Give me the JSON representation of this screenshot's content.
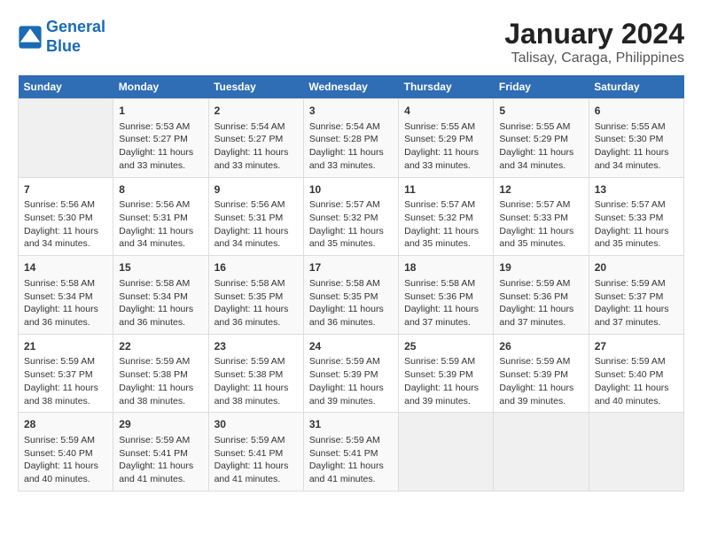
{
  "logo": {
    "line1": "General",
    "line2": "Blue"
  },
  "title": "January 2024",
  "subtitle": "Talisay, Caraga, Philippines",
  "headers": [
    "Sunday",
    "Monday",
    "Tuesday",
    "Wednesday",
    "Thursday",
    "Friday",
    "Saturday"
  ],
  "weeks": [
    [
      {
        "day": "",
        "info": ""
      },
      {
        "day": "1",
        "info": "Sunrise: 5:53 AM\nSunset: 5:27 PM\nDaylight: 11 hours\nand 33 minutes."
      },
      {
        "day": "2",
        "info": "Sunrise: 5:54 AM\nSunset: 5:27 PM\nDaylight: 11 hours\nand 33 minutes."
      },
      {
        "day": "3",
        "info": "Sunrise: 5:54 AM\nSunset: 5:28 PM\nDaylight: 11 hours\nand 33 minutes."
      },
      {
        "day": "4",
        "info": "Sunrise: 5:55 AM\nSunset: 5:29 PM\nDaylight: 11 hours\nand 33 minutes."
      },
      {
        "day": "5",
        "info": "Sunrise: 5:55 AM\nSunset: 5:29 PM\nDaylight: 11 hours\nand 34 minutes."
      },
      {
        "day": "6",
        "info": "Sunrise: 5:55 AM\nSunset: 5:30 PM\nDaylight: 11 hours\nand 34 minutes."
      }
    ],
    [
      {
        "day": "7",
        "info": "Sunrise: 5:56 AM\nSunset: 5:30 PM\nDaylight: 11 hours\nand 34 minutes."
      },
      {
        "day": "8",
        "info": "Sunrise: 5:56 AM\nSunset: 5:31 PM\nDaylight: 11 hours\nand 34 minutes."
      },
      {
        "day": "9",
        "info": "Sunrise: 5:56 AM\nSunset: 5:31 PM\nDaylight: 11 hours\nand 34 minutes."
      },
      {
        "day": "10",
        "info": "Sunrise: 5:57 AM\nSunset: 5:32 PM\nDaylight: 11 hours\nand 35 minutes."
      },
      {
        "day": "11",
        "info": "Sunrise: 5:57 AM\nSunset: 5:32 PM\nDaylight: 11 hours\nand 35 minutes."
      },
      {
        "day": "12",
        "info": "Sunrise: 5:57 AM\nSunset: 5:33 PM\nDaylight: 11 hours\nand 35 minutes."
      },
      {
        "day": "13",
        "info": "Sunrise: 5:57 AM\nSunset: 5:33 PM\nDaylight: 11 hours\nand 35 minutes."
      }
    ],
    [
      {
        "day": "14",
        "info": "Sunrise: 5:58 AM\nSunset: 5:34 PM\nDaylight: 11 hours\nand 36 minutes."
      },
      {
        "day": "15",
        "info": "Sunrise: 5:58 AM\nSunset: 5:34 PM\nDaylight: 11 hours\nand 36 minutes."
      },
      {
        "day": "16",
        "info": "Sunrise: 5:58 AM\nSunset: 5:35 PM\nDaylight: 11 hours\nand 36 minutes."
      },
      {
        "day": "17",
        "info": "Sunrise: 5:58 AM\nSunset: 5:35 PM\nDaylight: 11 hours\nand 36 minutes."
      },
      {
        "day": "18",
        "info": "Sunrise: 5:58 AM\nSunset: 5:36 PM\nDaylight: 11 hours\nand 37 minutes."
      },
      {
        "day": "19",
        "info": "Sunrise: 5:59 AM\nSunset: 5:36 PM\nDaylight: 11 hours\nand 37 minutes."
      },
      {
        "day": "20",
        "info": "Sunrise: 5:59 AM\nSunset: 5:37 PM\nDaylight: 11 hours\nand 37 minutes."
      }
    ],
    [
      {
        "day": "21",
        "info": "Sunrise: 5:59 AM\nSunset: 5:37 PM\nDaylight: 11 hours\nand 38 minutes."
      },
      {
        "day": "22",
        "info": "Sunrise: 5:59 AM\nSunset: 5:38 PM\nDaylight: 11 hours\nand 38 minutes."
      },
      {
        "day": "23",
        "info": "Sunrise: 5:59 AM\nSunset: 5:38 PM\nDaylight: 11 hours\nand 38 minutes."
      },
      {
        "day": "24",
        "info": "Sunrise: 5:59 AM\nSunset: 5:39 PM\nDaylight: 11 hours\nand 39 minutes."
      },
      {
        "day": "25",
        "info": "Sunrise: 5:59 AM\nSunset: 5:39 PM\nDaylight: 11 hours\nand 39 minutes."
      },
      {
        "day": "26",
        "info": "Sunrise: 5:59 AM\nSunset: 5:39 PM\nDaylight: 11 hours\nand 39 minutes."
      },
      {
        "day": "27",
        "info": "Sunrise: 5:59 AM\nSunset: 5:40 PM\nDaylight: 11 hours\nand 40 minutes."
      }
    ],
    [
      {
        "day": "28",
        "info": "Sunrise: 5:59 AM\nSunset: 5:40 PM\nDaylight: 11 hours\nand 40 minutes."
      },
      {
        "day": "29",
        "info": "Sunrise: 5:59 AM\nSunset: 5:41 PM\nDaylight: 11 hours\nand 41 minutes."
      },
      {
        "day": "30",
        "info": "Sunrise: 5:59 AM\nSunset: 5:41 PM\nDaylight: 11 hours\nand 41 minutes."
      },
      {
        "day": "31",
        "info": "Sunrise: 5:59 AM\nSunset: 5:41 PM\nDaylight: 11 hours\nand 41 minutes."
      },
      {
        "day": "",
        "info": ""
      },
      {
        "day": "",
        "info": ""
      },
      {
        "day": "",
        "info": ""
      }
    ]
  ]
}
